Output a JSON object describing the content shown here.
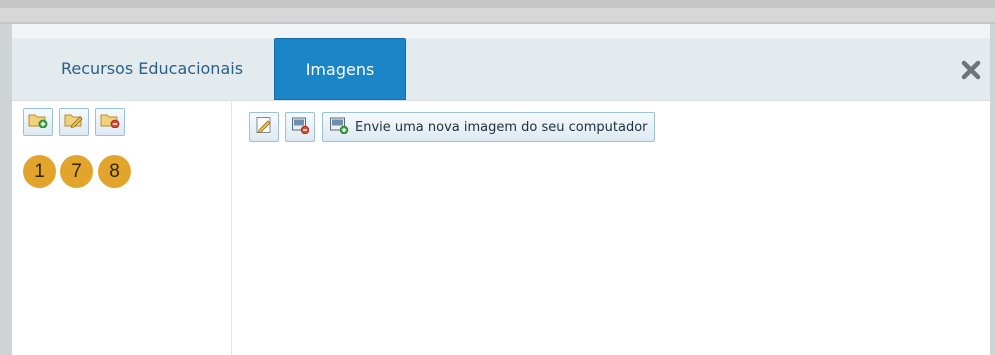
{
  "tabs": [
    {
      "label": "Recursos Educacionais",
      "active": false
    },
    {
      "label": "Imagens",
      "active": true
    }
  ],
  "close_icon": "close-icon",
  "folder_toolbar": {
    "buttons": [
      {
        "icon": "folder-add-icon"
      },
      {
        "icon": "folder-edit-icon"
      },
      {
        "icon": "folder-delete-icon"
      }
    ]
  },
  "annotations": [
    "1",
    "7",
    "8"
  ],
  "image_toolbar": {
    "buttons": [
      {
        "icon": "image-edit-icon"
      },
      {
        "icon": "image-delete-icon"
      }
    ],
    "upload_button": {
      "icon": "image-upload-icon",
      "label": "Envie uma nova imagem do seu computador"
    }
  },
  "colors": {
    "active_tab": "#1a86c7",
    "tab_text": "#2b5f85",
    "badge": "#e2a42a"
  }
}
